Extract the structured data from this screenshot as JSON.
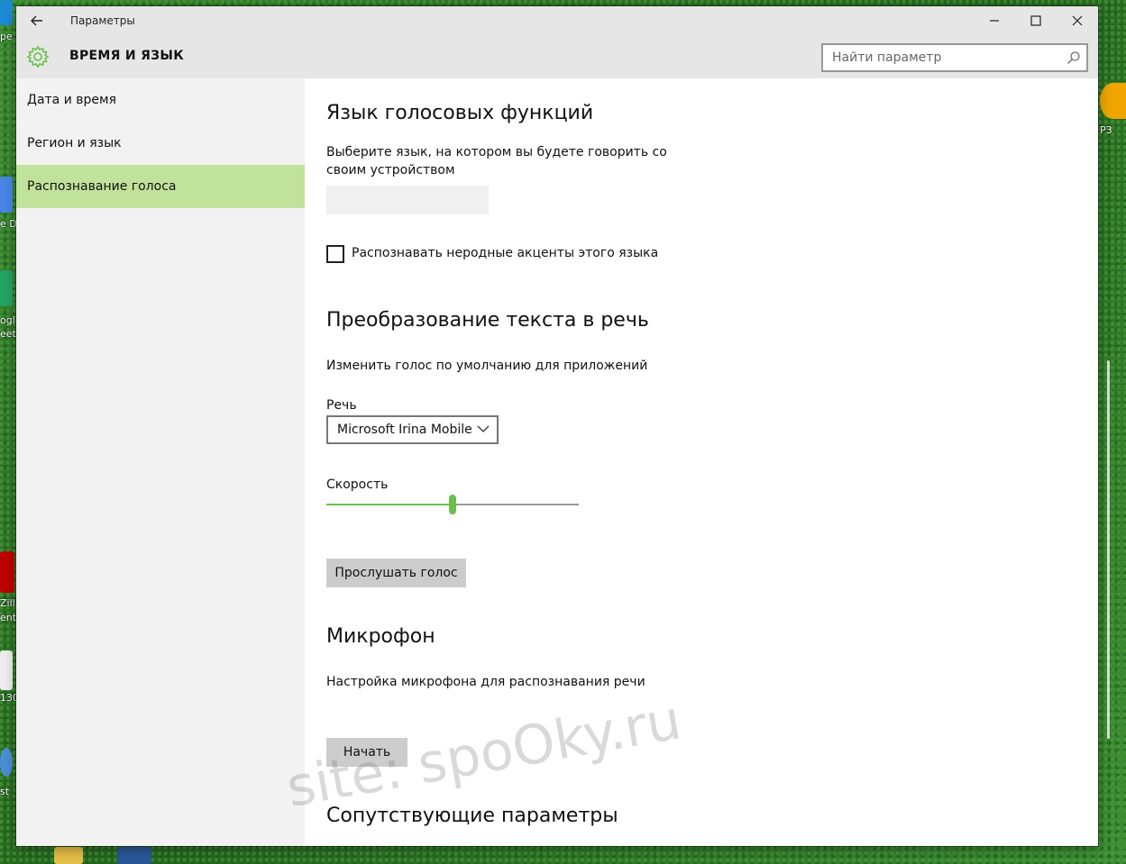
{
  "desktop": {
    "fragments": [
      "pe",
      "e Do",
      "ogle",
      "eets",
      "Zilla",
      "ent",
      "130",
      "st",
      "P3"
    ]
  },
  "window": {
    "title": "Параметры",
    "controls": {
      "minimize": "—",
      "maximize": "□",
      "close": "✕"
    }
  },
  "header": {
    "section": "ВРЕМЯ И ЯЗЫК",
    "search_placeholder": "Найти параметр"
  },
  "sidebar": {
    "items": [
      {
        "label": "Дата и время",
        "active": false
      },
      {
        "label": "Регион и язык",
        "active": false
      },
      {
        "label": "Распознавание голоса",
        "active": true
      }
    ]
  },
  "main": {
    "voice_lang": {
      "heading": "Язык голосовых функций",
      "description": "Выберите язык, на котором вы будете говорить со своим устройством",
      "selected_language": "",
      "accent_checkbox_label": "Распознавать неродные акценты этого языка",
      "accent_checked": false
    },
    "tts": {
      "heading": "Преобразование текста в речь",
      "description": "Изменить голос по умолчанию для приложений",
      "voice_label": "Речь",
      "voice_value": "Microsoft Irina Mobile",
      "speed_label": "Скорость",
      "speed_fraction": 0.5,
      "listen_button": "Прослушать голос"
    },
    "microphone": {
      "heading": "Микрофон",
      "description": "Настройка микрофона для распознавания речи",
      "start_button": "Начать"
    },
    "related": {
      "heading": "Сопутствующие параметры"
    }
  },
  "watermark": "site: spoOky.ru",
  "colors": {
    "accent": "#6cc04a",
    "active_nav": "#c0e29a",
    "titlebar": "#e6e6e6",
    "sidebar": "#f2f2f2"
  },
  "icons": [
    "back-arrow-icon",
    "gear-icon",
    "search-icon",
    "chevron-down-icon"
  ]
}
